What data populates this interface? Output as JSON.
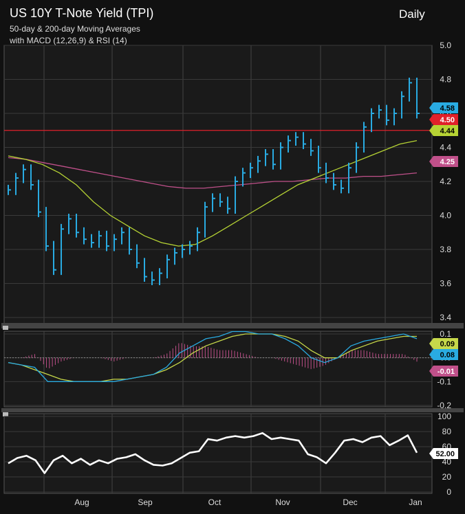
{
  "header": {
    "title": "US 10Y T-Note Yield (TPI)",
    "subtitle1": "50-day & 200-day Moving Averages",
    "subtitle2": "with MACD (12,26,9) & RSI (14)",
    "period": "Daily"
  },
  "colors": {
    "price": "#29abe2",
    "ma50": "#b6d334",
    "ma200": "#c0508a",
    "level": "#e0202a",
    "macd": "#29abe2",
    "signal": "#c6d84a",
    "histogram": "#c0508a",
    "rsi": "#ffffff"
  },
  "chart_data": [
    {
      "type": "line",
      "name": "price",
      "x_labels": [
        "Aug",
        "Sep",
        "Oct",
        "Nov",
        "Dec",
        "Jan"
      ],
      "ylim": [
        3.4,
        5.0
      ],
      "yticks": [
        "5.0",
        "4.8",
        "4.6",
        "4.4",
        "4.2",
        "4.0",
        "3.8",
        "3.6",
        "3.4"
      ],
      "series": [
        {
          "values": [
            4.15,
            4.22,
            4.27,
            4.18,
            4.02,
            3.82,
            3.68,
            3.92,
            3.98,
            3.9,
            3.86,
            3.84,
            3.88,
            3.82,
            3.86,
            3.9,
            3.8,
            3.72,
            3.64,
            3.62,
            3.66,
            3.74,
            3.78,
            3.8,
            3.82,
            3.9,
            4.05,
            4.1,
            4.08,
            4.04,
            4.2,
            4.25,
            4.28,
            4.32,
            4.36,
            4.3,
            4.4,
            4.44,
            4.46,
            4.42,
            4.38,
            4.28,
            4.22,
            4.18,
            4.16,
            4.28,
            4.4,
            4.52,
            4.6,
            4.62,
            4.56,
            4.6,
            4.7,
            4.78,
            4.6
          ]
        },
        {
          "values": [
            4.35,
            4.33,
            4.3,
            4.25,
            4.18,
            4.08,
            4.0,
            3.94,
            3.88,
            3.84,
            3.82,
            3.83,
            3.88,
            3.94,
            4.0,
            4.06,
            4.12,
            4.18,
            4.22,
            4.26,
            4.3,
            4.34,
            4.38,
            4.42,
            4.44
          ]
        },
        {
          "values": [
            4.34,
            4.33,
            4.31,
            4.29,
            4.27,
            4.25,
            4.23,
            4.21,
            4.19,
            4.17,
            4.16,
            4.16,
            4.17,
            4.18,
            4.19,
            4.2,
            4.2,
            4.21,
            4.22,
            4.22,
            4.23,
            4.23,
            4.24,
            4.25
          ]
        }
      ],
      "level": 4.5,
      "labels": [
        "4.58",
        "4.50",
        "4.44",
        "4.25"
      ]
    },
    {
      "type": "line",
      "name": "macd",
      "ylim": [
        -0.2,
        0.1
      ],
      "yticks": [
        "0.1",
        "0.0",
        "-0.1",
        "-0.2"
      ],
      "series": [
        {
          "values": [
            -0.02,
            -0.03,
            -0.04,
            -0.1,
            -0.1,
            -0.1,
            -0.1,
            -0.1,
            -0.1,
            -0.09,
            -0.08,
            -0.07,
            -0.04,
            0.02,
            0.05,
            0.08,
            0.09,
            0.11,
            0.11,
            0.1,
            0.1,
            0.08,
            0.05,
            0.0,
            -0.02,
            0.0,
            0.05,
            0.07,
            0.08,
            0.09,
            0.1,
            0.08
          ]
        },
        {
          "values": [
            -0.02,
            -0.03,
            -0.05,
            -0.07,
            -0.09,
            -0.1,
            -0.1,
            -0.1,
            -0.09,
            -0.09,
            -0.08,
            -0.07,
            -0.05,
            -0.02,
            0.02,
            0.05,
            0.07,
            0.09,
            0.1,
            0.1,
            0.1,
            0.09,
            0.07,
            0.03,
            0.0,
            0.0,
            0.03,
            0.05,
            0.07,
            0.08,
            0.09,
            0.09
          ]
        }
      ],
      "labels": [
        "0.09",
        "0.08",
        "-0.01"
      ]
    },
    {
      "type": "line",
      "name": "rsi",
      "ylim": [
        0,
        100
      ],
      "yticks": [
        "100",
        "80",
        "60",
        "40",
        "20",
        "0"
      ],
      "series": [
        {
          "values": [
            38,
            45,
            48,
            42,
            25,
            42,
            48,
            38,
            44,
            36,
            42,
            38,
            44,
            46,
            50,
            42,
            36,
            35,
            38,
            45,
            52,
            54,
            70,
            68,
            72,
            74,
            72,
            74,
            78,
            70,
            72,
            70,
            68,
            50,
            46,
            38,
            52,
            68,
            70,
            66,
            72,
            74,
            62,
            68,
            75,
            52
          ]
        }
      ],
      "labels": [
        "52.00"
      ]
    }
  ]
}
